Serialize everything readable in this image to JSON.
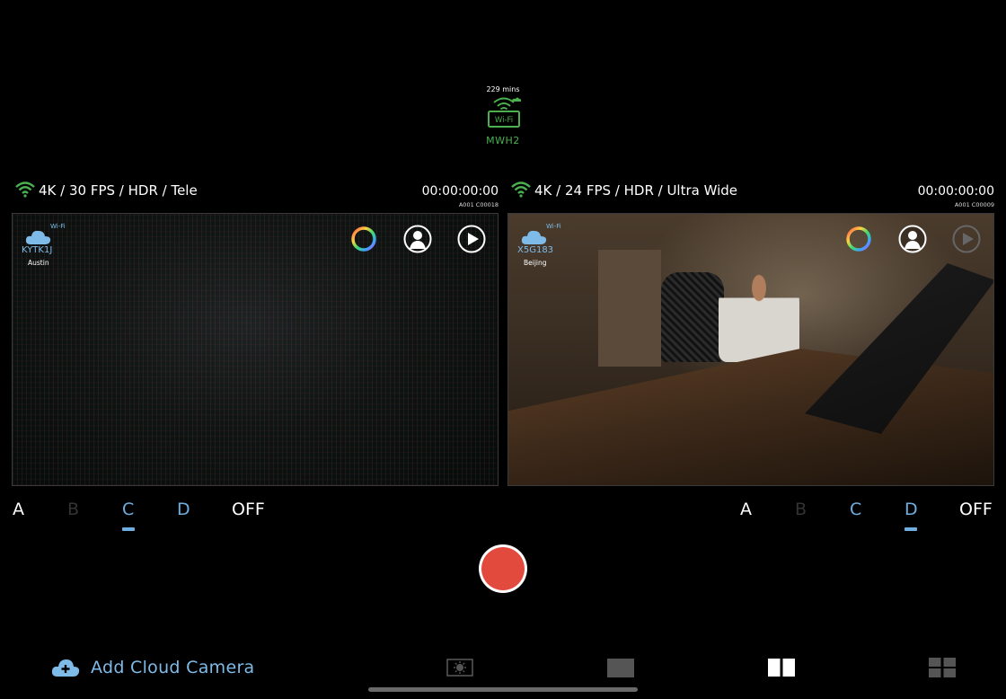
{
  "hotspot": {
    "minutes": "229 mins",
    "wifi_label": "Wi-Fi",
    "ssid": "MWH2"
  },
  "cameras": [
    {
      "spec": "4K / 30 FPS / HDR / Tele",
      "timecode": "00:00:00:00",
      "clip": "A001 C00018",
      "badge_wifi": "Wi-Fi",
      "cloud_id": "KYTK1J",
      "location": "Austin",
      "slots": [
        "A",
        "B",
        "C",
        "D",
        "OFF"
      ],
      "selected_slot": "C"
    },
    {
      "spec": "4K / 24 FPS / HDR / Ultra Wide",
      "timecode": "00:00:00:00",
      "clip": "A001 C00009",
      "badge_wifi": "Wi-Fi",
      "cloud_id": "X5G183",
      "location": "Beijing",
      "slots": [
        "A",
        "B",
        "C",
        "D",
        "OFF"
      ],
      "selected_slot": "D"
    }
  ],
  "bottom_bar": {
    "add_cloud_label": "Add Cloud Camera",
    "views": [
      "exposure-view-icon",
      "single-view-icon",
      "split-view-icon",
      "grid-view-icon"
    ],
    "active_view": "split-view-icon"
  },
  "colors": {
    "accent_blue": "#6faee0",
    "wifi_green": "#4caf50",
    "record_red": "#e24a3d"
  }
}
